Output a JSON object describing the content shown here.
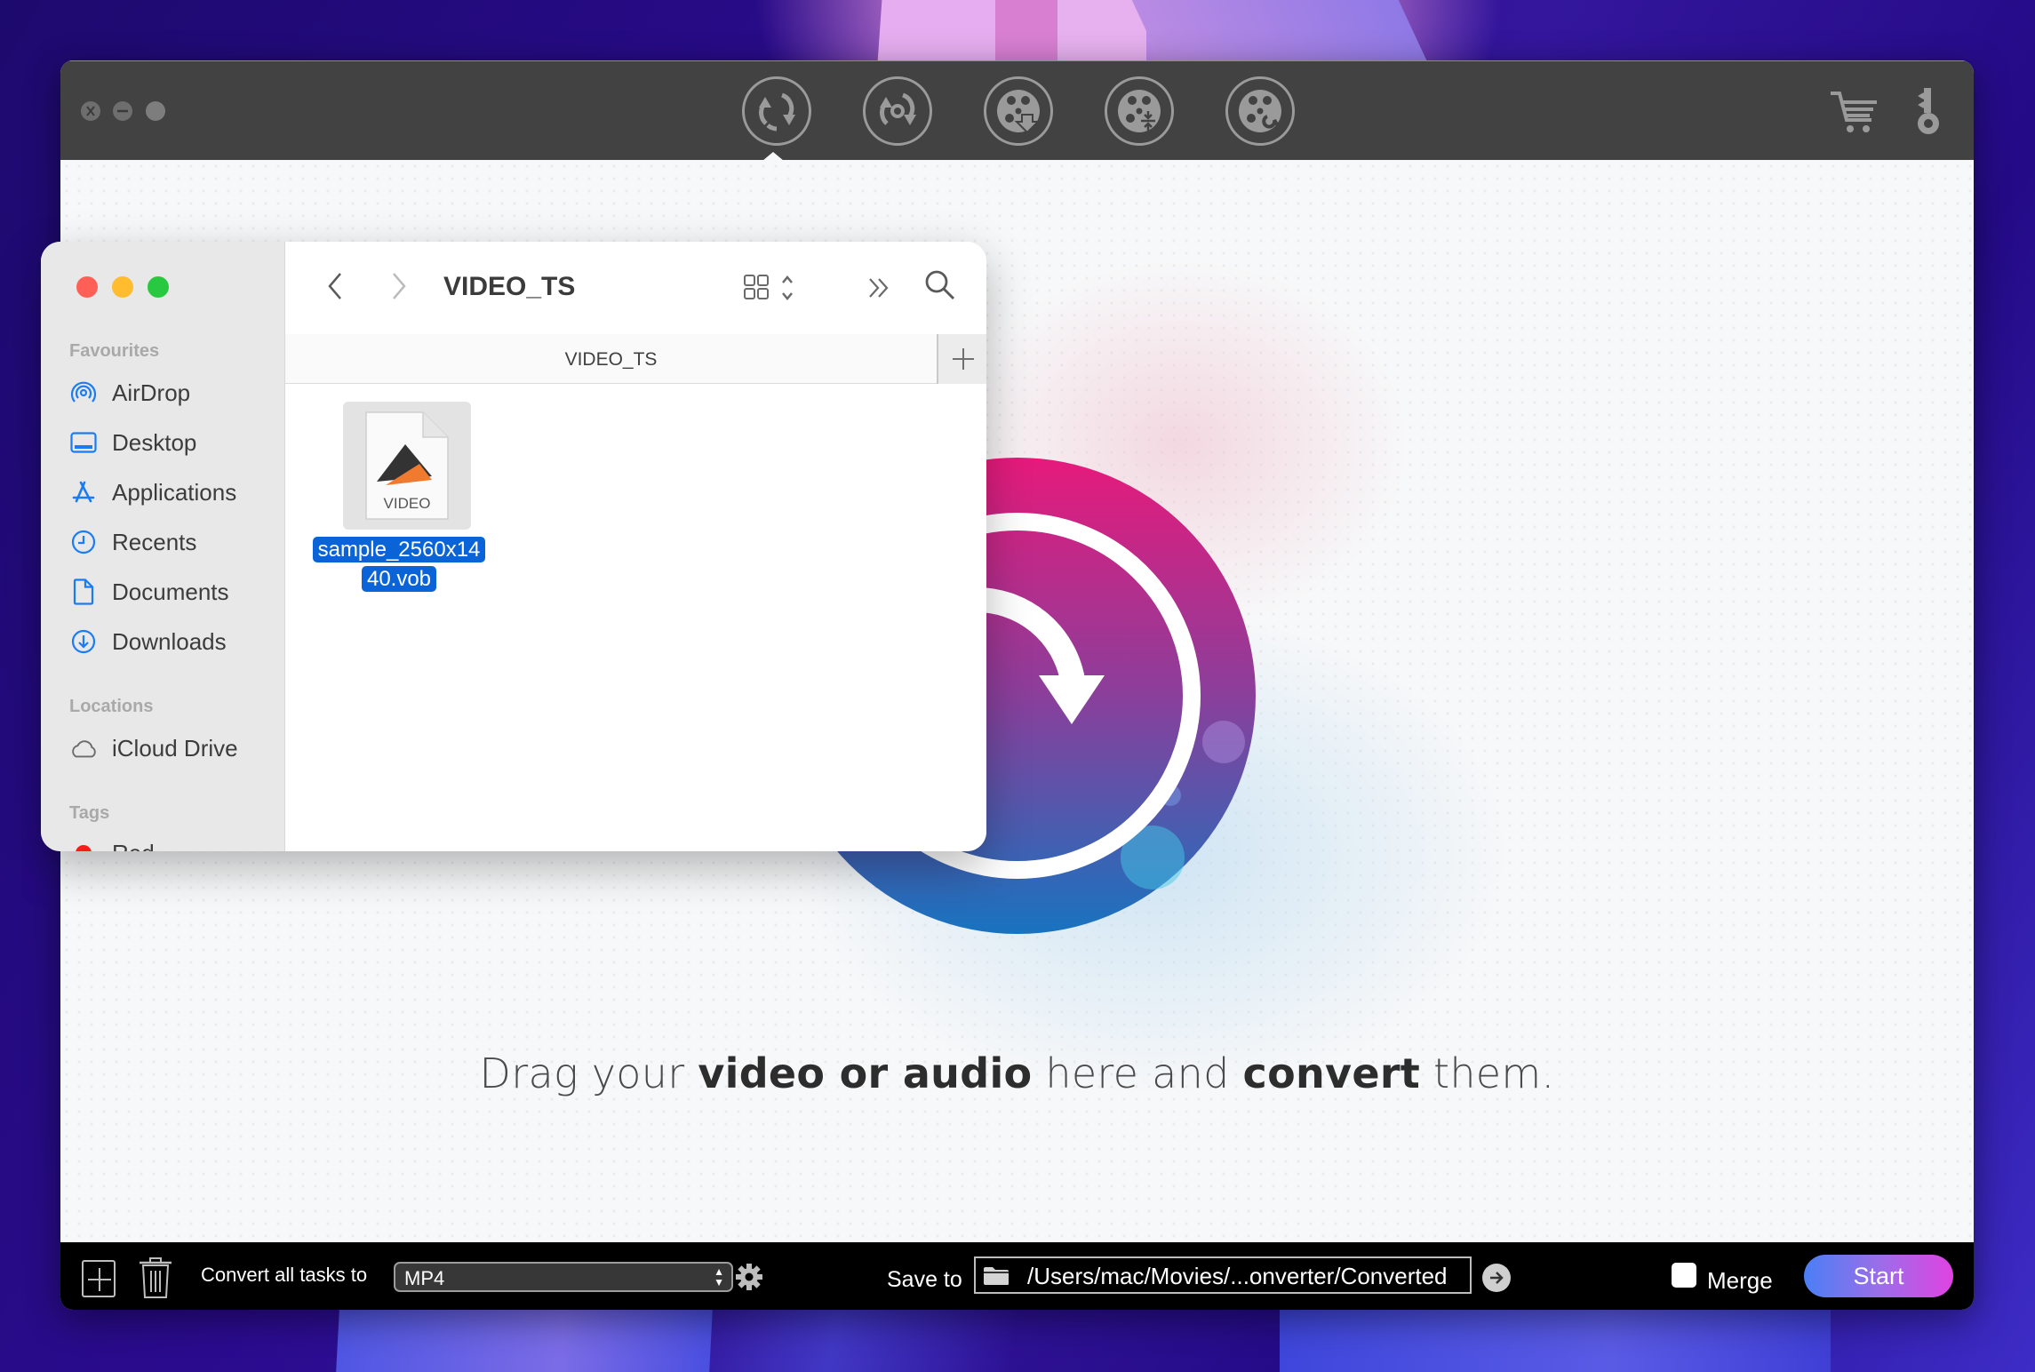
{
  "app": {
    "toolbar": {
      "tools": [
        {
          "name": "convert-tool",
          "icon": "convert-arrows-icon",
          "active": true
        },
        {
          "name": "rip-disc-tool",
          "icon": "disc-rotate-icon",
          "active": false
        },
        {
          "name": "download-tool",
          "icon": "film-reel-download-icon",
          "active": false
        },
        {
          "name": "compress-tool",
          "icon": "film-reel-compress-icon",
          "active": false
        },
        {
          "name": "toolbox-tool",
          "icon": "film-reel-wrench-icon",
          "active": false
        }
      ],
      "right_icons": [
        "cart-icon",
        "key-icon"
      ]
    },
    "drop_zone": {
      "text_part1": "Drag your ",
      "text_bold1": "video or audio",
      "text_part2": " here and ",
      "text_bold2": "convert",
      "text_part3": " them."
    },
    "bottom_bar": {
      "convert_label": "Convert all tasks to",
      "format_value": "MP4",
      "save_label": "Save to",
      "save_path": "/Users/mac/Movies/...onverter/Converted",
      "merge_label": "Merge",
      "merge_checked": false,
      "start_label": "Start"
    },
    "colors": {
      "titlebar": "#424242",
      "start_gradient_from": "#4a7ff5",
      "start_gradient_to": "#e043e1",
      "logo_top": "#e61a7b",
      "logo_bottom": "#1873bf"
    }
  },
  "finder": {
    "sections": {
      "favourites": "Favourites",
      "locations": "Locations",
      "tags": "Tags"
    },
    "favourites": [
      {
        "label": "AirDrop",
        "icon": "airdrop-icon"
      },
      {
        "label": "Desktop",
        "icon": "desktop-icon"
      },
      {
        "label": "Applications",
        "icon": "applications-icon"
      },
      {
        "label": "Recents",
        "icon": "clock-icon"
      },
      {
        "label": "Documents",
        "icon": "document-icon"
      },
      {
        "label": "Downloads",
        "icon": "download-icon"
      }
    ],
    "locations": [
      {
        "label": "iCloud Drive",
        "icon": "cloud-icon"
      }
    ],
    "tags": [
      {
        "label": "Red",
        "color": "#ff1a1a"
      }
    ],
    "toolbar": {
      "title": "VIDEO_TS"
    },
    "tab_title": "VIDEO_TS",
    "files": [
      {
        "name": "sample_2560x1440.vob",
        "name_line1": "sample_2560x14",
        "name_line2": "40.vob",
        "icon_label": "VIDEO",
        "selected": true
      }
    ]
  }
}
